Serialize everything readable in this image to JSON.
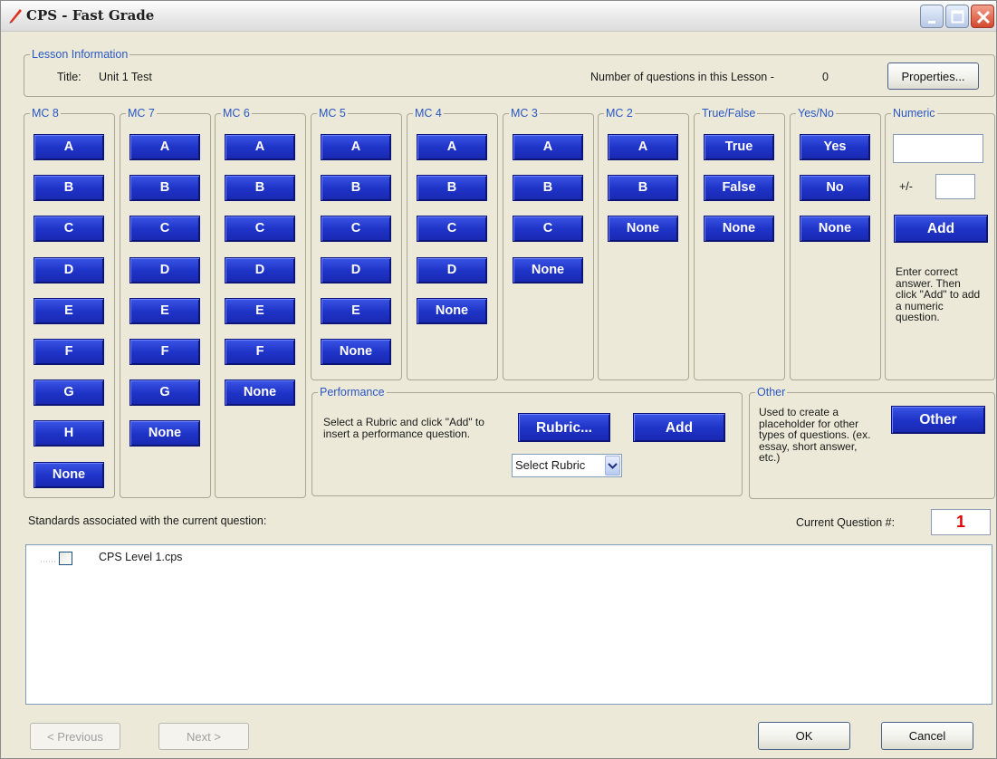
{
  "window": {
    "title": "CPS - Fast Grade"
  },
  "lesson": {
    "group_label": "Lesson Information",
    "title_label": "Title:",
    "title_value": "Unit 1 Test",
    "count_label": "Number of questions in this Lesson -",
    "count_value": "0",
    "properties_button": "Properties..."
  },
  "mc_columns": [
    {
      "label": "MC 8",
      "buttons": [
        "A",
        "B",
        "C",
        "D",
        "E",
        "F",
        "G",
        "H",
        "None"
      ]
    },
    {
      "label": "MC 7",
      "buttons": [
        "A",
        "B",
        "C",
        "D",
        "E",
        "F",
        "G",
        "None"
      ]
    },
    {
      "label": "MC 6",
      "buttons": [
        "A",
        "B",
        "C",
        "D",
        "E",
        "F",
        "None"
      ]
    },
    {
      "label": "MC 5",
      "buttons": [
        "A",
        "B",
        "C",
        "D",
        "E",
        "None"
      ]
    },
    {
      "label": "MC 4",
      "buttons": [
        "A",
        "B",
        "C",
        "D",
        "None"
      ]
    },
    {
      "label": "MC 3",
      "buttons": [
        "A",
        "B",
        "C",
        "None"
      ]
    },
    {
      "label": "MC 2",
      "buttons": [
        "A",
        "B",
        "None"
      ]
    },
    {
      "label": "True/False",
      "buttons": [
        "True",
        "False",
        "None"
      ]
    },
    {
      "label": "Yes/No",
      "buttons": [
        "Yes",
        "No",
        "None"
      ]
    }
  ],
  "numeric": {
    "label": "Numeric",
    "answer_value": "",
    "tolerance_label": "+/-",
    "tolerance_value": "",
    "add_button": "Add",
    "help_text": "Enter correct answer.  Then click \"Add\" to add a numeric question."
  },
  "performance": {
    "label": "Performance",
    "help_text": "Select a Rubric and click \"Add\" to insert a performance question.",
    "rubric_button": "Rubric...",
    "add_button": "Add",
    "select_value": "Select Rubric"
  },
  "other": {
    "label": "Other",
    "help_text": "Used to create a placeholder for other types of questions.  (ex. essay, short answer, etc.)",
    "button": "Other"
  },
  "standards": {
    "label": "Standards associated with the current question:",
    "current_question_label": "Current Question #:",
    "current_question_value": "1",
    "tree_items": [
      "CPS Level 1.cps"
    ]
  },
  "footer": {
    "previous": "< Previous",
    "next": "Next >",
    "ok": "OK",
    "cancel": "Cancel"
  },
  "colors": {
    "group_label": "#2a57c4",
    "answer_button": "#1f34c8",
    "question_number": "#e00000"
  }
}
